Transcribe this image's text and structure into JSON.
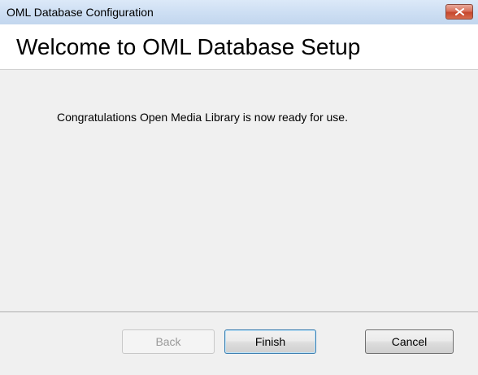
{
  "window": {
    "title": "OML Database Configuration"
  },
  "header": {
    "title": "Welcome to OML Database Setup"
  },
  "main": {
    "message": "Congratulations Open Media Library is now ready for use."
  },
  "buttons": {
    "back_label": "Back",
    "back_enabled": false,
    "finish_label": "Finish",
    "cancel_label": "Cancel"
  },
  "icons": {
    "close": "close-icon"
  },
  "colors": {
    "titlebar": "#cfe0f4",
    "close_button": "#c5472d",
    "header_background": "#ffffff",
    "body_background": "#f0f0f0",
    "default_button_border": "#3c7fb1"
  }
}
